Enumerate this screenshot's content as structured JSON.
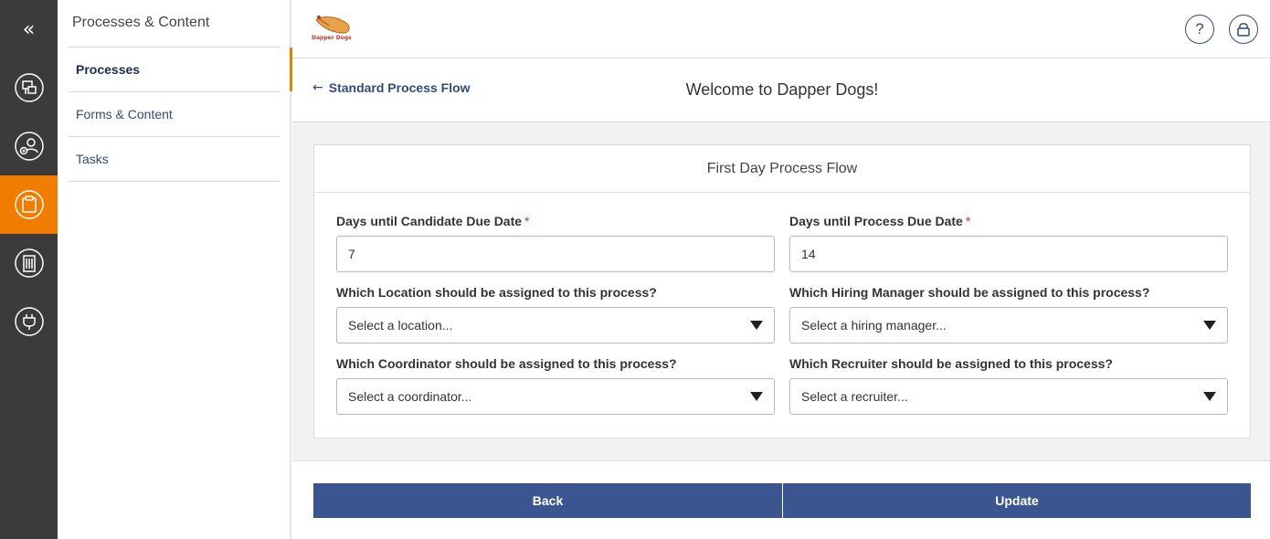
{
  "rail": {
    "collapse_glyph": "«",
    "items": [
      {
        "icon": "process-flow-icon",
        "active": false
      },
      {
        "icon": "user-add-icon",
        "active": false
      },
      {
        "icon": "clipboard-icon",
        "active": true
      },
      {
        "icon": "building-icon",
        "active": false
      },
      {
        "icon": "plug-icon",
        "active": false
      }
    ],
    "accent": "#f07d00"
  },
  "subnav": {
    "title": "Processes & Content",
    "items": [
      {
        "label": "Processes",
        "active": true
      },
      {
        "label": "Forms & Content",
        "active": false
      },
      {
        "label": "Tasks",
        "active": false
      }
    ]
  },
  "topbar": {
    "logo_text": "Dapper Dogs",
    "help_glyph": "?",
    "help_icon": "help-icon",
    "lock_icon": "lock-icon"
  },
  "page_header": {
    "back_label": "Standard Process Flow",
    "back_glyph": "🡐",
    "welcome": "Welcome to Dapper Dogs!"
  },
  "form": {
    "title": "First Day Process Flow",
    "candidate_due": {
      "label": "Days until Candidate Due Date",
      "required_mark": "*",
      "value": "7"
    },
    "process_due": {
      "label": "Days until Process Due Date",
      "required_mark": "*",
      "value": "14"
    },
    "location": {
      "label": "Which Location should be assigned to this process?",
      "selected": "Select a location..."
    },
    "hiring_manager": {
      "label": "Which Hiring Manager should be assigned to this process?",
      "selected": "Select a hiring manager..."
    },
    "coordinator": {
      "label": "Which Coordinator should be assigned to this process?",
      "selected": "Select a coordinator..."
    },
    "recruiter": {
      "label": "Which Recruiter should be assigned to this process?",
      "selected": "Select a recruiter..."
    }
  },
  "footer": {
    "back_label": "Back",
    "update_label": "Update",
    "button_color": "#3a5590"
  }
}
